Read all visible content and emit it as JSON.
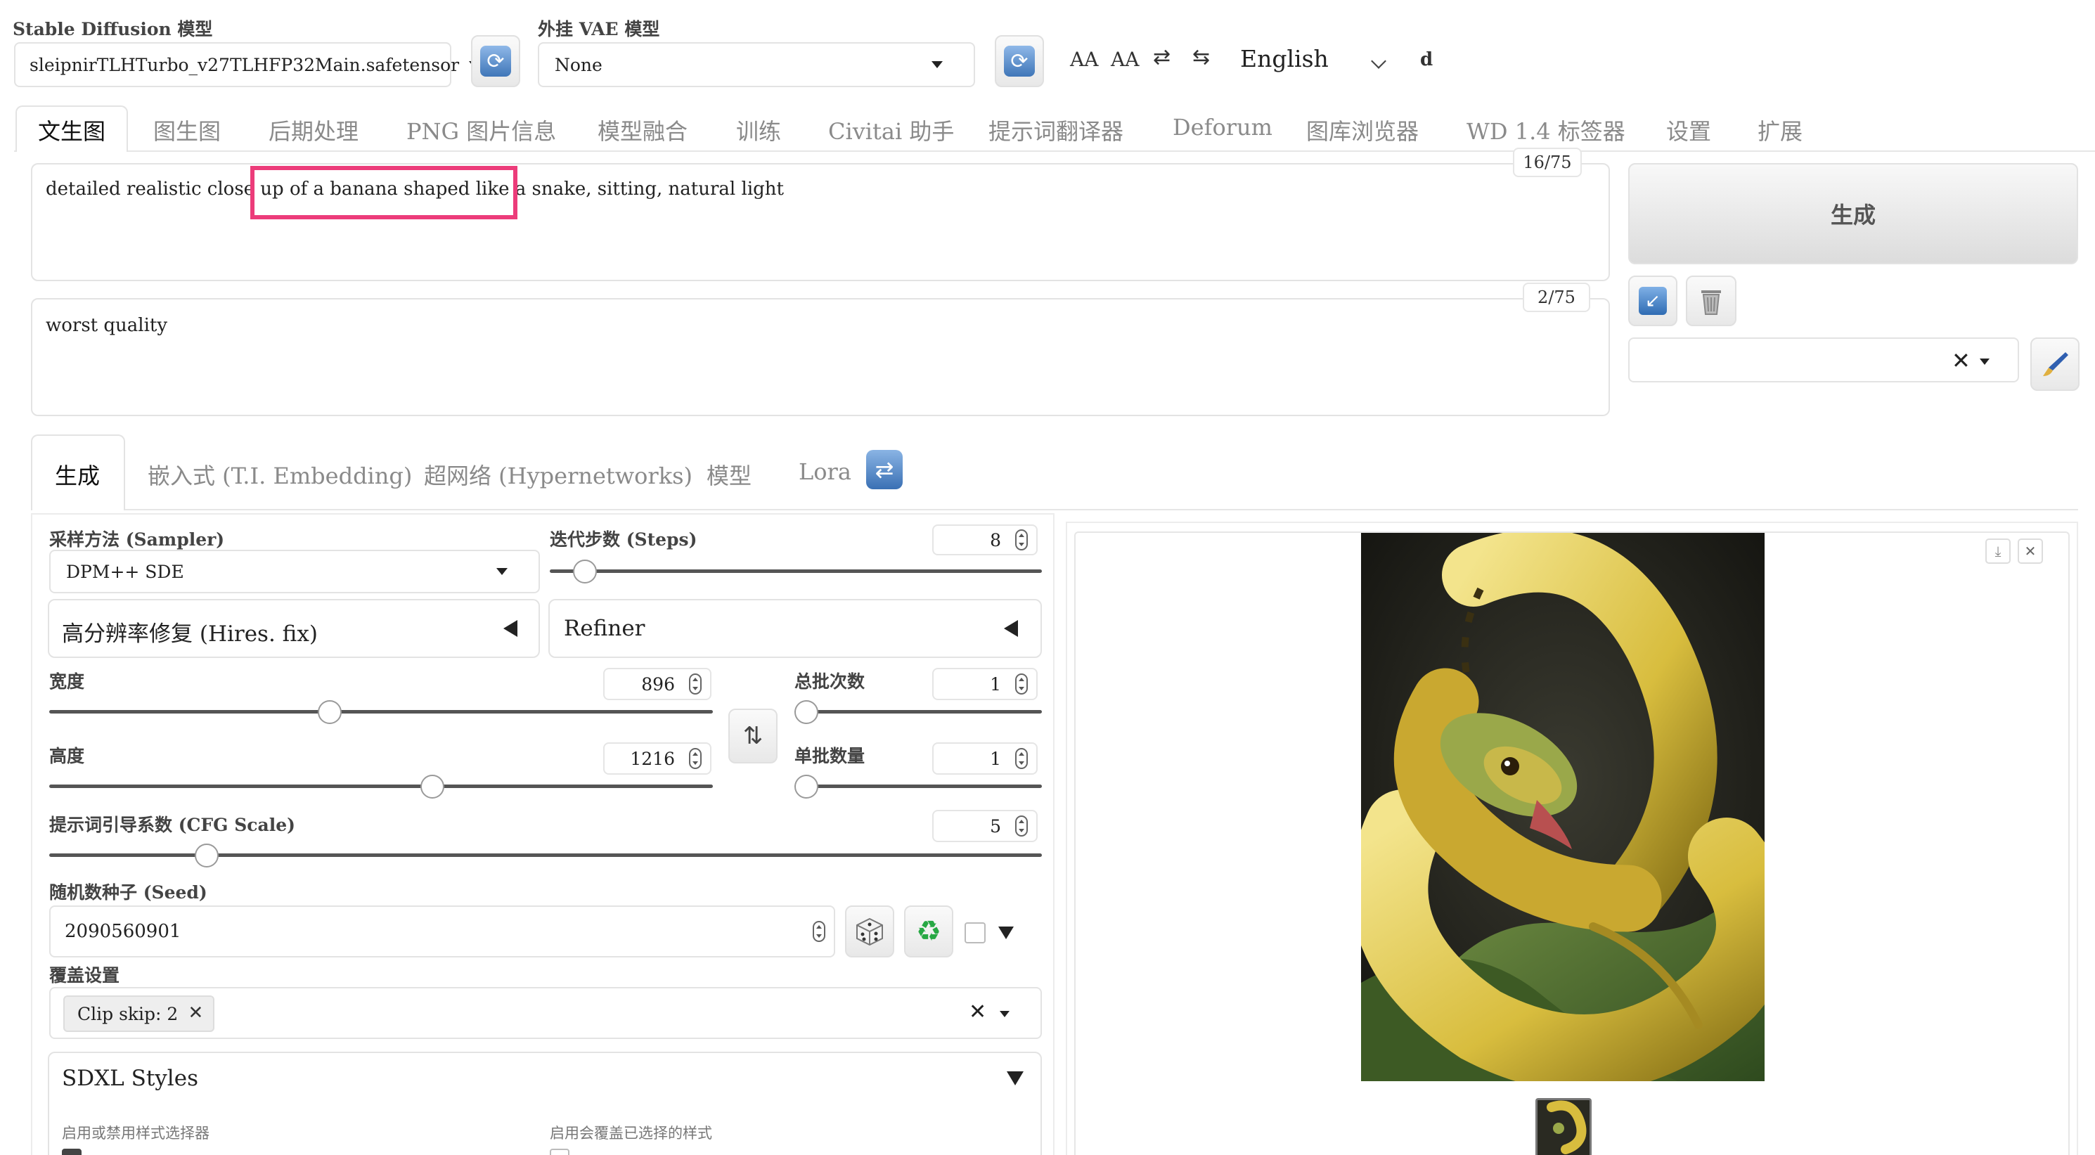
{
  "top": {
    "sd_model_label": "Stable Diffusion 模型",
    "sd_model_value": "sleipnirTLHTurbo_v27TLHFP32Main.safetensor",
    "vae_label": "外挂 VAE 模型",
    "vae_value": "None",
    "font_inc": "AA",
    "font_dec": "AA",
    "swap_glyph": "⇄",
    "swap2_glyph": "⇆",
    "language": "English",
    "d_label": "d"
  },
  "tabs": [
    {
      "label": "文生图"
    },
    {
      "label": "图生图"
    },
    {
      "label": "后期处理"
    },
    {
      "label": "PNG 图片信息"
    },
    {
      "label": "模型融合"
    },
    {
      "label": "训练"
    },
    {
      "label": "Civitai 助手"
    },
    {
      "label": "提示词翻译器"
    },
    {
      "label": "Deforum"
    },
    {
      "label": "图库浏览器"
    },
    {
      "label": "WD 1.4 标签器"
    },
    {
      "label": "设置"
    },
    {
      "label": "扩展"
    }
  ],
  "prompt": {
    "positive": "detailed realistic close up of a banana shaped like a snake, sitting, natural light",
    "positive_count": "16/75",
    "negative": "worst quality",
    "negative_count": "2/75",
    "highlight_color": "#ec3c7a"
  },
  "generate_button": "生成",
  "subtabs": [
    {
      "label": "生成"
    },
    {
      "label": "嵌入式 (T.I. Embedding)"
    },
    {
      "label": "超网络 (Hypernetworks)"
    },
    {
      "label": "模型"
    },
    {
      "label": "Lora"
    }
  ],
  "settings": {
    "sampler_label": "采样方法 (Sampler)",
    "sampler_value": "DPM++ SDE",
    "steps_label": "迭代步数 (Steps)",
    "steps_value": "8",
    "steps_fraction": 0.05,
    "hires_label": "高分辨率修复 (Hires. fix)",
    "refiner_label": "Refiner",
    "width_label": "宽度",
    "width_value": "896",
    "width_fraction": 0.42,
    "height_label": "高度",
    "height_value": "1216",
    "height_fraction": 0.58,
    "batch_count_label": "总批次数",
    "batch_count_value": "1",
    "batch_count_fraction": 0.0,
    "batch_size_label": "单批数量",
    "batch_size_value": "1",
    "batch_size_fraction": 0.0,
    "cfg_label": "提示词引导系数 (CFG Scale)",
    "cfg_value": "5",
    "cfg_fraction": 0.15,
    "seed_label": "随机数种子 (Seed)",
    "seed_value": "2090560901",
    "override_label": "覆盖设置",
    "override_chip": "Clip skip: 2",
    "sdxl_label": "SDXL Styles",
    "style_enable_label": "启用或禁用样式选择器",
    "style_override_label": "启用会覆盖已选择的样式"
  }
}
